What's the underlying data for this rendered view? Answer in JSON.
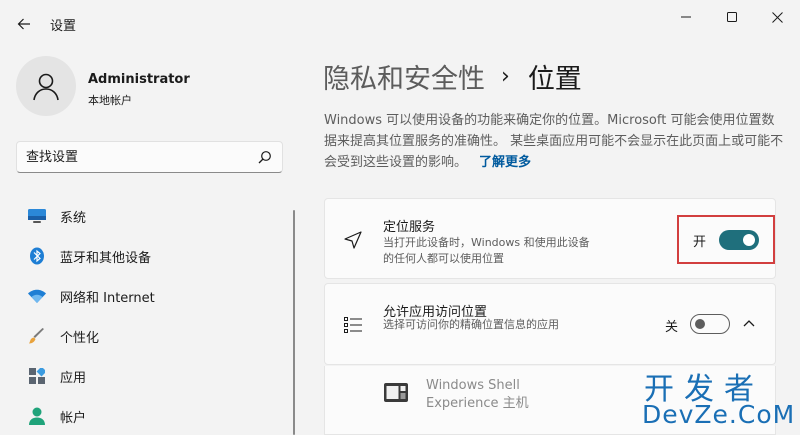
{
  "app": {
    "title": "设置"
  },
  "profile": {
    "name": "Administrator",
    "account_type": "本地帐户"
  },
  "search": {
    "placeholder": "查找设置"
  },
  "sidebar": {
    "items": [
      {
        "label": "系统",
        "icon": "monitor-icon"
      },
      {
        "label": "蓝牙和其他设备",
        "icon": "bluetooth-icon"
      },
      {
        "label": "网络和 Internet",
        "icon": "wifi-icon"
      },
      {
        "label": "个性化",
        "icon": "brush-icon"
      },
      {
        "label": "应用",
        "icon": "apps-icon"
      },
      {
        "label": "帐户",
        "icon": "person-icon"
      }
    ]
  },
  "breadcrumb": {
    "parent": "隐私和安全性",
    "separator": "›",
    "current": "位置"
  },
  "description": {
    "text": "Windows 可以使用设备的功能来确定你的位置。Microsoft 可能会使用位置数据来提高其位置服务的准确性。 某些桌面应用可能不会显示在此页面上或可能不会受到这些设置的影响。",
    "link": "了解更多"
  },
  "location_service": {
    "title": "定位服务",
    "desc": "当打开此设备时，Windows 和使用此设备的任何人都可以使用位置",
    "state_label": "开",
    "on": true
  },
  "app_access": {
    "title": "允许应用访问位置",
    "desc": "选择可访问你的精确位置信息的应用",
    "state_label": "关",
    "on": false
  },
  "apps": [
    {
      "name": "Windows Shell Experience 主机",
      "icon": "shell-app-icon"
    }
  ],
  "watermark": {
    "line1": "开发者",
    "line2": "DevZe.CoM"
  },
  "colors": {
    "accent": "#1f6f7c",
    "link": "#005a9e",
    "highlight": "#d23f3f"
  }
}
